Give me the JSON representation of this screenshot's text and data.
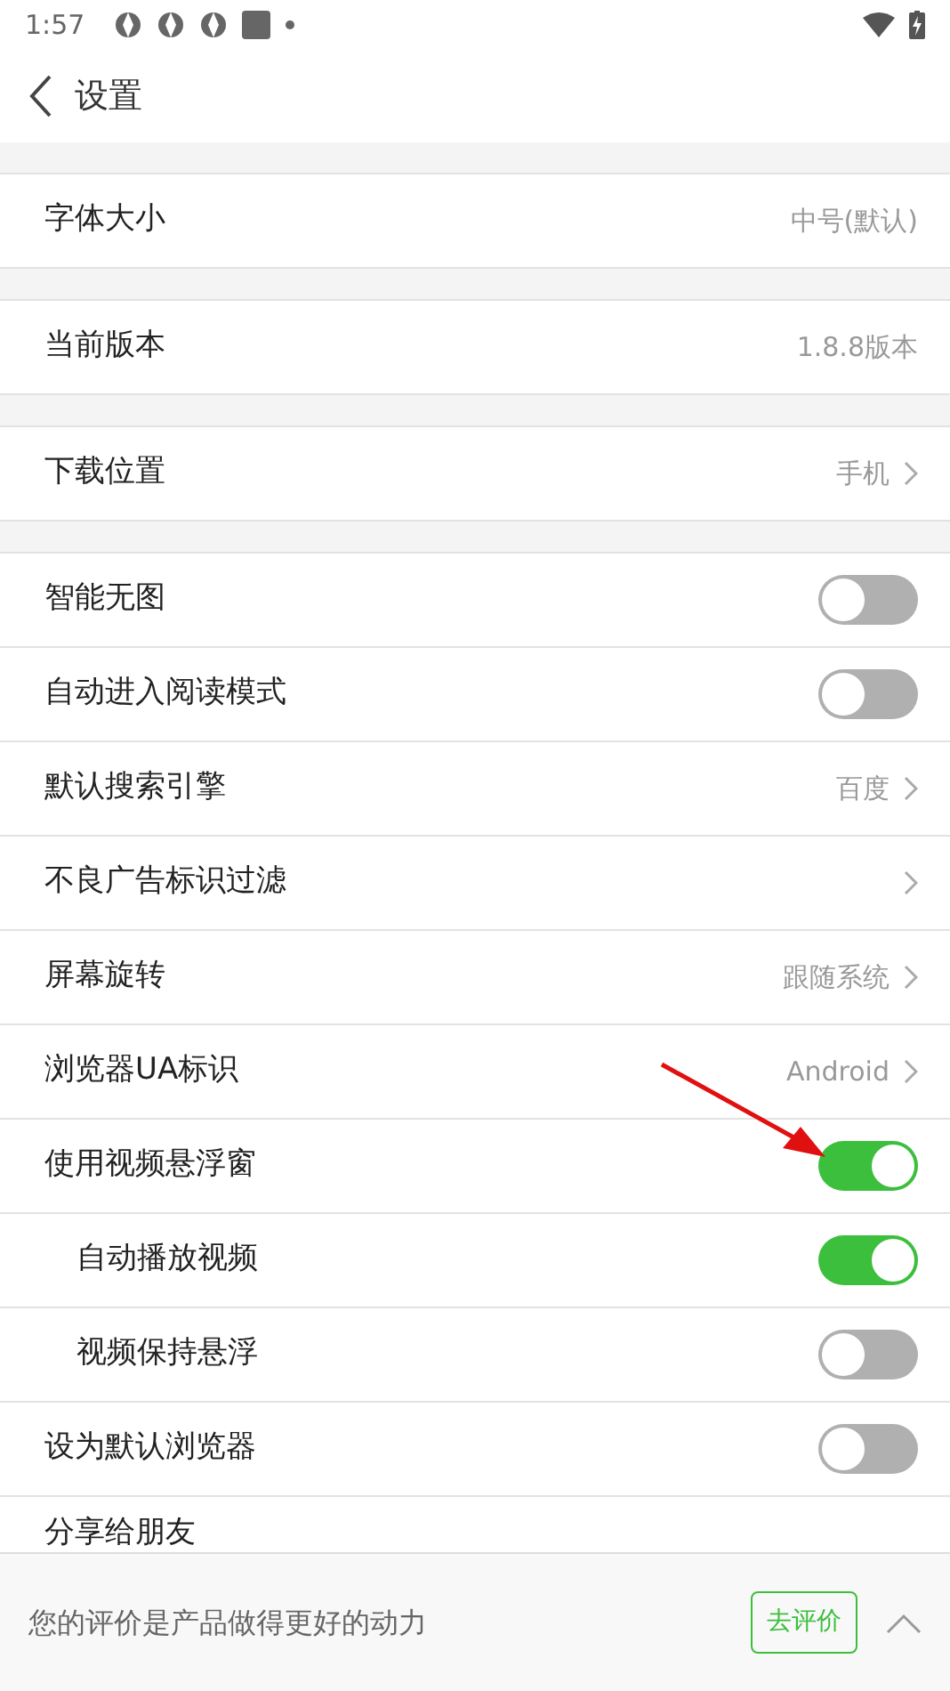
{
  "status_bar": {
    "time": "1:57"
  },
  "header": {
    "title": "设置"
  },
  "sections": [
    {
      "items": [
        {
          "kind": "value",
          "label": "字体大小",
          "value": "中号(默认)"
        }
      ]
    },
    {
      "items": [
        {
          "kind": "value",
          "label": "当前版本",
          "value": "1.8.8版本"
        }
      ]
    },
    {
      "items": [
        {
          "kind": "link",
          "label": "下载位置",
          "value": "手机"
        }
      ]
    },
    {
      "items": [
        {
          "kind": "toggle",
          "label": "智能无图",
          "on": false
        },
        {
          "kind": "toggle",
          "label": "自动进入阅读模式",
          "on": false
        },
        {
          "kind": "link",
          "label": "默认搜索引擎",
          "value": "百度"
        },
        {
          "kind": "link",
          "label": "不良广告标识过滤"
        },
        {
          "kind": "link",
          "label": "屏幕旋转",
          "value": "跟随系统"
        },
        {
          "kind": "link",
          "label": "浏览器UA标识",
          "value": "Android"
        },
        {
          "kind": "toggle",
          "label": "使用视频悬浮窗",
          "on": true,
          "children": [
            {
              "kind": "toggle",
              "label": "自动播放视频",
              "on": true
            },
            {
              "kind": "toggle",
              "label": "视频保持悬浮",
              "on": false
            }
          ]
        },
        {
          "kind": "toggle",
          "label": "设为默认浏览器",
          "on": false
        },
        {
          "kind": "plain",
          "label": "分享给朋友"
        }
      ]
    }
  ],
  "rating_bar": {
    "message": "您的评价是产品做得更好的动力",
    "button": "去评价"
  }
}
